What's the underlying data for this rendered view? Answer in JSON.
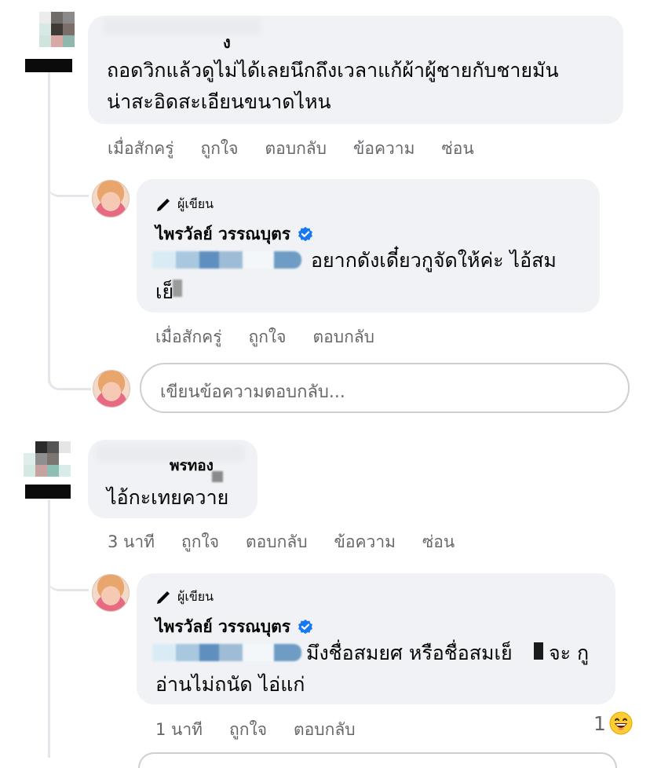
{
  "comment1": {
    "author_fragment": "ง",
    "text_line1": "ถอดวิกแล้วดูไม่ได้เลยนึกถึงเวลาแก้ผ้าผู้ชายกับชายมัน",
    "text_line2": "น่าสะอิดสะเอียนขนาดไหน",
    "actions": [
      "เมื่อสักครู่",
      "ถูกใจ",
      "ตอบกลับ",
      "ข้อความ",
      "ซ่อน"
    ]
  },
  "reply1": {
    "badge": "ผู้เขียน",
    "author": "ไพรวัลย์ วรรณบุตร",
    "text_line1": "อยากดังเดี๋ยวกูจัดให้ค่ะ ไอ้สม",
    "text_line2": "เย็",
    "actions": [
      "เมื่อสักครู่",
      "ถูกใจ",
      "ตอบกลับ"
    ]
  },
  "reply_input": {
    "placeholder": "เขียนข้อความตอบกลับ..."
  },
  "comment2": {
    "author_fragment": "พรทอง",
    "text": "ไอ้กะเทยควาย",
    "actions": [
      "3 นาที",
      "ถูกใจ",
      "ตอบกลับ",
      "ข้อความ",
      "ซ่อน"
    ]
  },
  "reply2": {
    "badge": "ผู้เขียน",
    "author": "ไพรวัลย์ วรรณบุตร",
    "text_line1": "มึงชื่อสมยศ หรือชื่อสมเย็",
    "text_line1_tail": "จะ กู",
    "text_line2": "อ่านไม่ถนัด ไอ่แก่",
    "actions": [
      "1 นาที",
      "ถูกใจ",
      "ตอบกลับ"
    ],
    "reaction_count": "1",
    "reaction_icon": "laughing-emoji-icon"
  },
  "colors": {
    "bubble": "#f0f2f5",
    "muted": "#65676b",
    "verified": "#1877f2",
    "line": "#e4e6eb"
  }
}
